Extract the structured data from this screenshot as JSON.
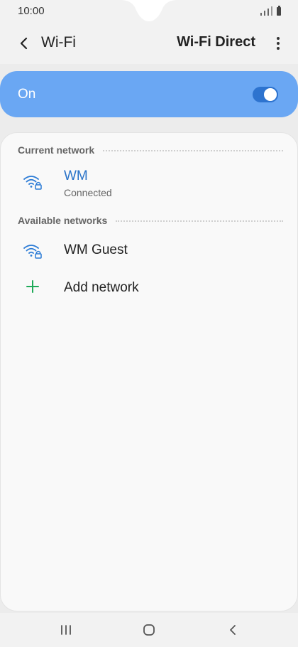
{
  "status_bar": {
    "time": "10:00"
  },
  "header": {
    "title": "Wi-Fi",
    "wifi_direct_label": "Wi-Fi Direct"
  },
  "toggle": {
    "label": "On",
    "state": "on",
    "accent_color": "#6aa7f3"
  },
  "sections": {
    "current": {
      "title": "Current network"
    },
    "available": {
      "title": "Available networks"
    }
  },
  "networks": {
    "current": {
      "name": "WM",
      "status": "Connected",
      "icon": "wifi-lock-icon"
    },
    "available": [
      {
        "name": "WM Guest",
        "icon": "wifi-lock-icon"
      }
    ],
    "add_label": "Add network"
  },
  "colors": {
    "connected_name": "#2872c8",
    "add_icon": "#1faa59"
  }
}
